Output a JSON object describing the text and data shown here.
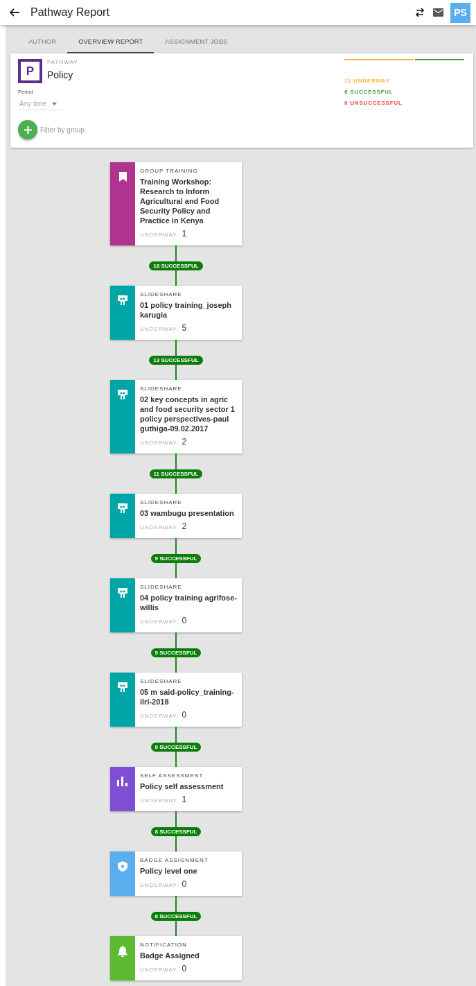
{
  "header": {
    "title": "Pathway Report",
    "avatar": "PS"
  },
  "tabs": [
    {
      "label": "AUTHOR",
      "selected": false
    },
    {
      "label": "OVERVIEW REPORT",
      "selected": true
    },
    {
      "label": "ASSIGNMENT JOBS",
      "selected": false
    }
  ],
  "pathway": {
    "logo": "P",
    "label": "PATHWAY",
    "name": "Policy",
    "period_label": "Period",
    "period_value": "Any time",
    "filter_label": "Filter by group",
    "progress": {
      "level": 0.58
    },
    "stats": [
      {
        "kind": "underway",
        "text": "11 UNDERWAY"
      },
      {
        "kind": "successful",
        "text": "8 SUCCESSFUL"
      },
      {
        "kind": "unsuccessful",
        "text": "0 UNSUCCESSFUL"
      }
    ]
  },
  "steps": [
    {
      "kind": "group_training",
      "type": "GROUP TRAINING",
      "title": "Training Workshop: Research to Inform Agricultural and Food Security Policy and Practice in Kenya",
      "underway_label": "UNDERWAY:",
      "underway": "1",
      "successful": "18 SUCCESSFUL"
    },
    {
      "kind": "slideshare",
      "type": "SLIDESHARE",
      "title": "01 policy training_joseph karugia",
      "underway_label": "UNDERWAY:",
      "underway": "5",
      "successful": "13 SUCCESSFUL"
    },
    {
      "kind": "slideshare",
      "type": "SLIDESHARE",
      "title": "02 key concepts in agric and food security sector 1 policy perspectives-paul guthiga-09.02.2017",
      "underway_label": "UNDERWAY:",
      "underway": "2",
      "successful": "11 SUCCESSFUL"
    },
    {
      "kind": "slideshare",
      "type": "SLIDESHARE",
      "title": "03 wambugu presentation",
      "underway_label": "UNDERWAY:",
      "underway": "2",
      "successful": "9 SUCCESSFUL"
    },
    {
      "kind": "slideshare",
      "type": "SLIDESHARE",
      "title": "04 policy training agrifose-willis",
      "underway_label": "UNDERWAY:",
      "underway": "0",
      "successful": "9 SUCCESSFUL"
    },
    {
      "kind": "slideshare",
      "type": "SLIDESHARE",
      "title": "05 m said-policy_training-ilri-2018",
      "underway_label": "UNDERWAY:",
      "underway": "0",
      "successful": "9 SUCCESSFUL"
    },
    {
      "kind": "self_assessment",
      "type": "SELF ASSESSMENT",
      "title": "Policy self assessment",
      "underway_label": "UNDERWAY:",
      "underway": "1",
      "successful": "8 SUCCESSFUL"
    },
    {
      "kind": "badge_assignment",
      "type": "BADGE ASSIGNMENT",
      "title": "Policy level one",
      "underway_label": "UNDERWAY:",
      "underway": "0",
      "successful": "8 SUCCESSFUL"
    },
    {
      "kind": "notification",
      "type": "NOTIFICATION",
      "title": "Badge Assigned",
      "underway_label": "UNDERWAY:",
      "underway": "0"
    }
  ]
}
